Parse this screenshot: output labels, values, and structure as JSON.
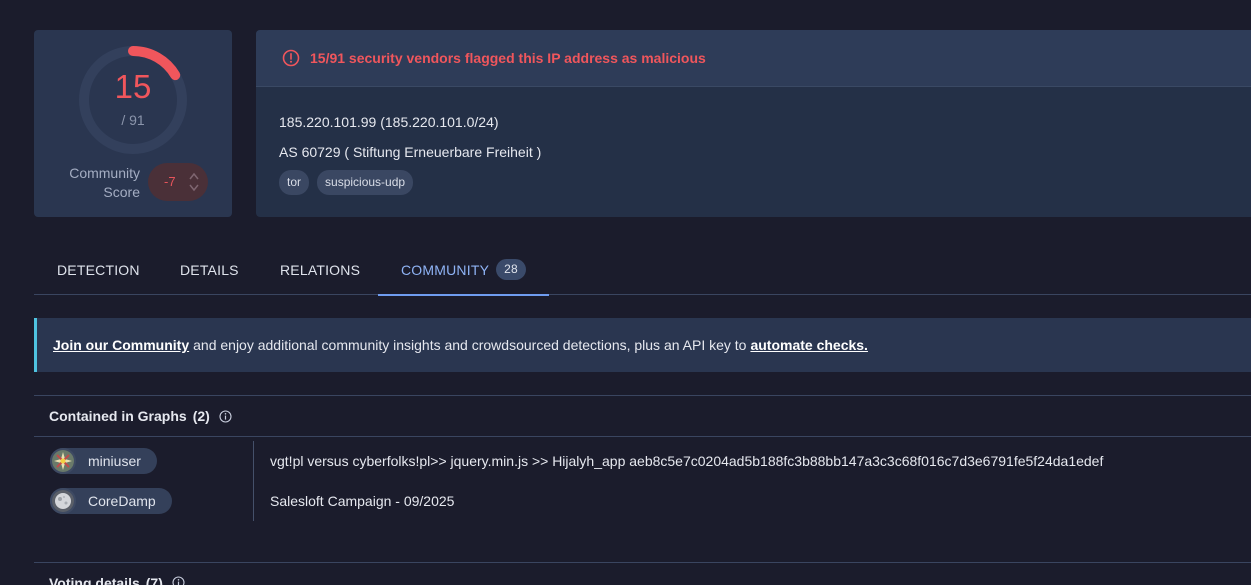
{
  "score": {
    "detections": "15",
    "total": "/ 91",
    "detection_fraction": 0.165,
    "community_label_line1": "Community",
    "community_label_line2": "Score",
    "community_value": "-7"
  },
  "alert": {
    "message": "15/91 security vendors flagged this IP address as malicious",
    "icon": "alert-circle-icon"
  },
  "ip": {
    "address_line": "185.220.101.99  (185.220.101.0/24)",
    "as_line": "AS 60729  ( Stiftung Erneuerbare Freiheit )",
    "tags": [
      "tor",
      "suspicious-udp"
    ]
  },
  "tabs": [
    {
      "label": "DETECTION"
    },
    {
      "label": "DETAILS"
    },
    {
      "label": "RELATIONS"
    },
    {
      "label": "COMMUNITY",
      "badge": "28"
    }
  ],
  "banner": {
    "join_link": "Join our Community",
    "middle_text": "and enjoy additional community insights and crowdsourced detections, plus an API key to",
    "automate_link": "automate checks."
  },
  "graphs": {
    "title": "Contained in Graphs",
    "count": "(2)",
    "rows": [
      {
        "user": "miniuser",
        "text": "vgt!pl versus cyberfolks!pl>> jquery.min.js >> Hijalyh_app aeb8c5e7c0204ad5b188fc3b88bb147a3c3c68f016c7d3e6791fe5f24da1edef"
      },
      {
        "user": "CoreDamp",
        "text": "Salesloft Campaign - 09/2025"
      }
    ]
  },
  "voting": {
    "title": "Voting details",
    "count": "(7)"
  },
  "colors": {
    "accent": "#6f9cf0",
    "danger": "#f0565c",
    "background": "#1b1c2c",
    "card": "#2a3650"
  }
}
